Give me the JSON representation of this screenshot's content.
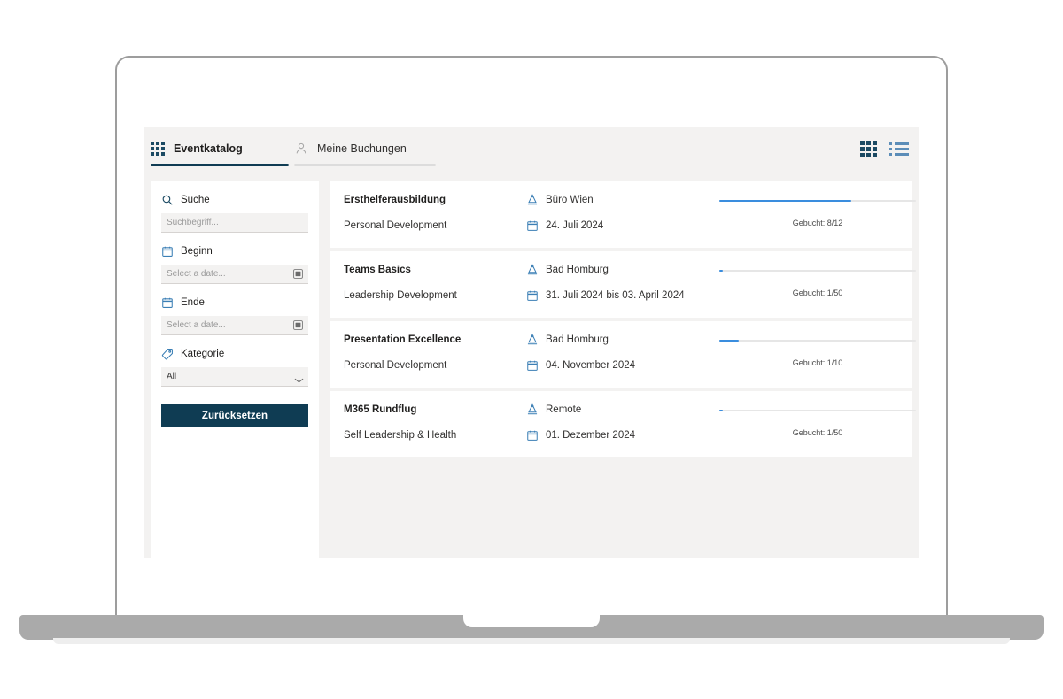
{
  "tabs": [
    {
      "label": "Eventkatalog",
      "icon": "grid-icon",
      "active": true
    },
    {
      "label": "Meine Buchungen",
      "icon": "person-icon",
      "active": false
    }
  ],
  "view_toggle": {
    "grid_label": "grid-view",
    "list_label": "list-view",
    "active": "grid",
    "active_color": "#1b4a63",
    "inactive_color": "#5b8db8"
  },
  "sidebar": {
    "filters": [
      {
        "label": "Suche",
        "icon": "search-icon",
        "placeholder": "Suchbegriff...",
        "value": "",
        "type": "text"
      },
      {
        "label": "Beginn",
        "icon": "calendar-icon",
        "placeholder": "Select a date...",
        "value": "",
        "type": "date"
      },
      {
        "label": "Ende",
        "icon": "calendar-icon",
        "placeholder": "Select a date...",
        "value": "",
        "type": "date"
      },
      {
        "label": "Kategorie",
        "icon": "tag-icon",
        "placeholder": "",
        "value": "All",
        "type": "select"
      }
    ],
    "reset_label": "Zurücksetzen",
    "reset_color": "#0f3c53"
  },
  "cards": [
    {
      "title": "Ersthelferausbildung",
      "category": "Personal Development",
      "location": "Büro Wien",
      "date": "24. Juli 2024",
      "booked_label": "Gebucht: 8/12",
      "booked": 8,
      "capacity": 12,
      "progress_percent": 67
    },
    {
      "title": "Teams Basics",
      "category": "Leadership Development",
      "location": "Bad Homburg",
      "date": "31. Juli 2024 bis 03. April 2024",
      "booked_label": "Gebucht: 1/50",
      "booked": 1,
      "capacity": 50,
      "progress_percent": 2
    },
    {
      "title": "Presentation Excellence",
      "category": "Personal Development",
      "location": "Bad Homburg",
      "date": "04. November 2024",
      "booked_label": "Gebucht: 1/10",
      "booked": 1,
      "capacity": 10,
      "progress_percent": 10
    },
    {
      "title": "M365 Rundflug",
      "category": "Self Leadership & Health",
      "location": "Remote",
      "date": "01. Dezember 2024",
      "booked_label": "Gebucht: 1/50",
      "booked": 1,
      "capacity": 50,
      "progress_percent": 2
    }
  ],
  "theme": {
    "accent": "#0f3c53",
    "progress": "#3a8dde",
    "icon_blue": "#3b7fb5",
    "app_bg": "#f3f2f1"
  }
}
